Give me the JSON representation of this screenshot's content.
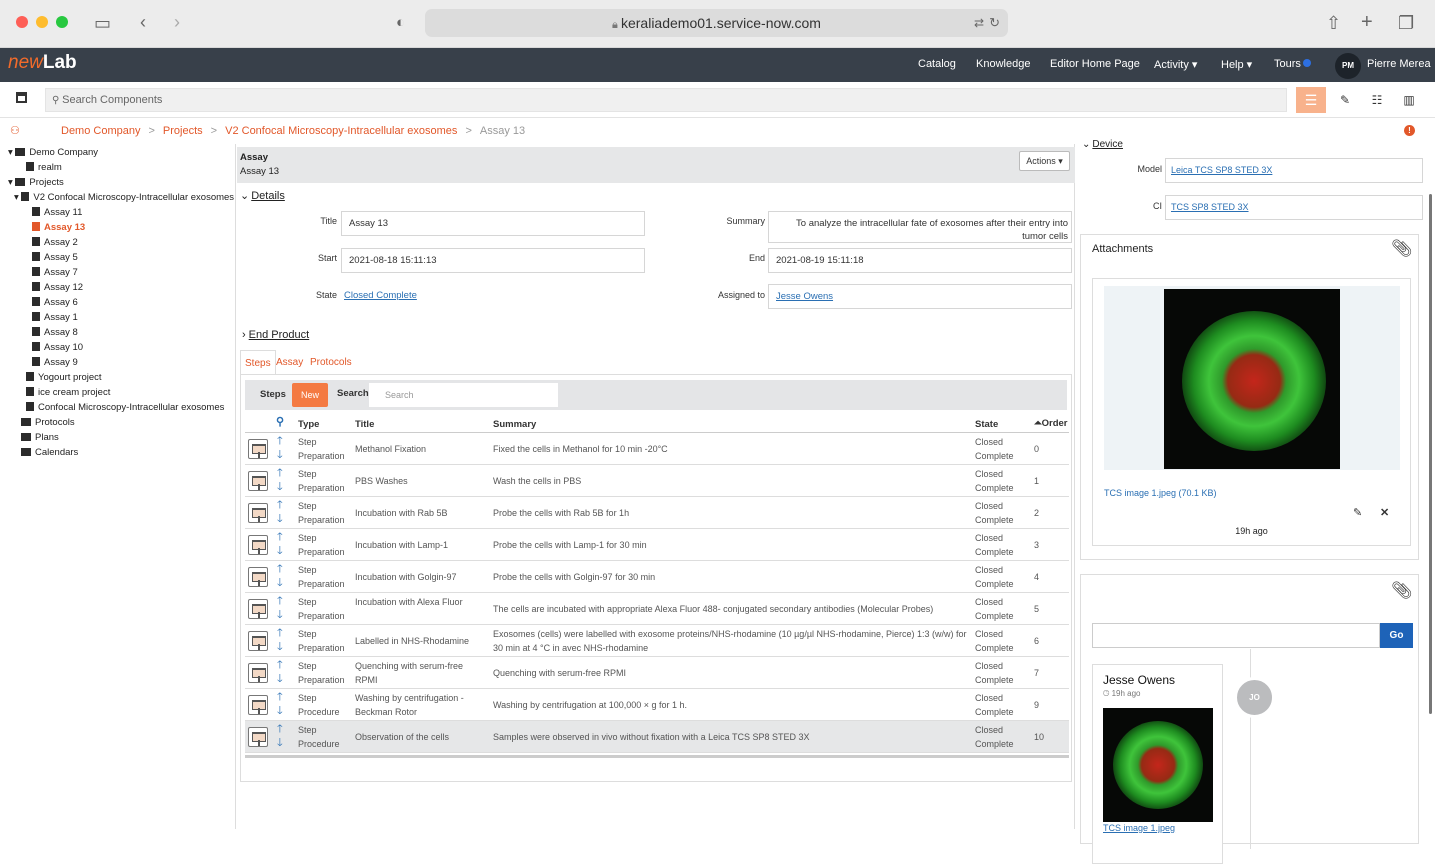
{
  "browser": {
    "url": "keraliademo01.service-now.com"
  },
  "app": {
    "logo_prefix": "new",
    "logo_main": "Lab",
    "nav": [
      "Catalog",
      "Knowledge",
      "Editor Home Page",
      "Activity ▾",
      "Help ▾",
      "Tours"
    ],
    "user_initials": "PM",
    "user_name": "Pierre Merea"
  },
  "toolbar": {
    "search_placeholder": "Search Components"
  },
  "breadcrumb": [
    "Demo Company",
    "Projects",
    "V2 Confocal Microscopy-Intracellular exosomes",
    "Assay 13"
  ],
  "tree": {
    "company": "Demo Company",
    "realm": "realm",
    "projects": "Projects",
    "project": "V2 Confocal Microscopy-Intracellular exosomes",
    "assays": [
      "Assay 11",
      "Assay 13",
      "Assay 2",
      "Assay 5",
      "Assay 7",
      "Assay 12",
      "Assay 6",
      "Assay 1",
      "Assay 8",
      "Assay 10",
      "Assay 9"
    ],
    "others": [
      "Yogourt project",
      "ice cream project",
      "Confocal Microscopy-Intracellular exosomes"
    ],
    "root_others": [
      "Protocols",
      "Plans",
      "Calendars"
    ]
  },
  "record": {
    "type": "Assay",
    "name": "Assay 13",
    "actions": "Actions ▾",
    "details_label": "Details",
    "title_label": "Title",
    "title": "Assay 13",
    "summary_label": "Summary",
    "summary": "To analyze the intracellular fate of exosomes after their entry into tumor cells",
    "start_label": "Start",
    "start": "2021-08-18 15:11:13",
    "end_label": "End",
    "end": "2021-08-19 15:11:18",
    "state_label": "State",
    "state": "Closed Complete",
    "assigned_label": "Assigned to",
    "assigned": "Jesse Owens",
    "end_product_label": "End Product"
  },
  "tabs": [
    "Steps",
    "Assay",
    "Protocols"
  ],
  "steps": {
    "label": "Steps",
    "new_label": "New",
    "search_label": "Search",
    "search_placeholder": "Search",
    "columns": {
      "type": "Type",
      "title": "Title",
      "summary": "Summary",
      "state": "State",
      "order": "Order"
    },
    "rows": [
      {
        "type": "Step Preparation",
        "title": "Methanol Fixation",
        "summary": "Fixed the cells in Methanol for 10 min -20°C",
        "state": "Closed Complete",
        "order": "0"
      },
      {
        "type": "Step Preparation",
        "title": "PBS Washes",
        "summary": "Wash the cells in PBS",
        "state": "Closed Complete",
        "order": "1"
      },
      {
        "type": "Step Preparation",
        "title": "Incubation with Rab 5B",
        "summary": "Probe the cells with Rab 5B for 1h",
        "state": "Closed Complete",
        "order": "2"
      },
      {
        "type": "Step Preparation",
        "title": "Incubation with Lamp-1",
        "summary": "Probe the cells with Lamp-1 for 30 min",
        "state": "Closed Complete",
        "order": "3"
      },
      {
        "type": "Step Preparation",
        "title": "Incubation with Golgin-97",
        "summary": "Probe the cells with Golgin-97 for 30 min",
        "state": "Closed Complete",
        "order": "4"
      },
      {
        "type": "Step Preparation",
        "title": "Incubation with Alexa Fluor",
        "summary": "The cells are incubated with appropriate Alexa Fluor 488- conjugated secondary antibodies (Molecular Probes)",
        "state": "Closed Complete",
        "order": "5"
      },
      {
        "type": "Step Preparation",
        "title": "Labelled in NHS-Rhodamine",
        "summary": "Exosomes (cells) were labelled with exosome proteins/NHS-rhodamine (10 µg/µl NHS-rhodamine, Pierce) 1:3 (w/w) for 30 min at 4 °C in avec NHS-rhodamine",
        "state": "Closed Complete",
        "order": "6"
      },
      {
        "type": "Step Preparation",
        "title": "Quenching with serum-free RPMI",
        "summary": "Quenching with serum-free RPMI",
        "state": "Closed Complete",
        "order": "7"
      },
      {
        "type": "Step Procedure",
        "title": "Washing by centrifugation - Beckman Rotor",
        "summary": "Washing by centrifugation at 100,000 × g for 1 h.",
        "state": "Closed Complete",
        "order": "9"
      },
      {
        "type": "Step Procedure",
        "title": "Observation of the cells",
        "summary": "Samples were observed in vivo without fixation with a Leica TCS SP8 STED 3X",
        "state": "Closed Complete",
        "order": "10"
      }
    ]
  },
  "device": {
    "label": "Device",
    "model_label": "Model",
    "model": "Leica TCS SP8 STED 3X",
    "ci_label": "CI",
    "ci": "TCS SP8 STED 3X"
  },
  "attachments": {
    "label": "Attachments",
    "file": "TCS image 1.jpeg (70.1 KB)",
    "time": "19h ago"
  },
  "activity": {
    "go_label": "Go",
    "author": "Jesse Owens",
    "time": "19h ago",
    "initials": "JO",
    "file_cut": "TCS image 1.jpeg"
  }
}
